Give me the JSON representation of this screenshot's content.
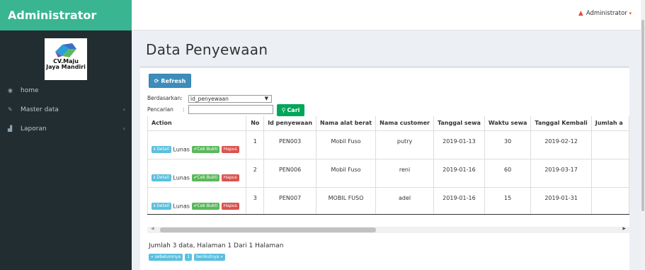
{
  "brand": "Administrator",
  "logo": {
    "line1": "CV.Maju",
    "line2": "Jaya Mandiri"
  },
  "sidebar": {
    "items": [
      {
        "label": "home",
        "icon": "dashboard-icon"
      },
      {
        "label": "Master data",
        "icon": "edit-icon",
        "has_chevron": true
      },
      {
        "label": "Laporan",
        "icon": "chart-icon",
        "has_chevron": true
      }
    ]
  },
  "topbar": {
    "user": "Administrator"
  },
  "page": {
    "title": "Data Penyewaan"
  },
  "toolbar": {
    "refresh_label": "Refresh",
    "filter_label": "Berdasarkan",
    "filter_value": "id_penyewaan",
    "search_label": "Pencarian",
    "search_value": "",
    "search_button": "Cari"
  },
  "table": {
    "headers": [
      "Action",
      "No",
      "Id penyewaan",
      "Nama alat berat",
      "Nama customer",
      "Tanggal sewa",
      "Waktu sewa",
      "Tanggal Kembali",
      "Jumlah a"
    ],
    "action_labels": {
      "detail": "Detail",
      "status": "Lunas",
      "cek": "Cek Bukti",
      "hapus": "Hapus"
    },
    "rows": [
      {
        "no": "1",
        "id": "PEN003",
        "alat": "Mobil Fuso",
        "customer": "putry",
        "tgl_sewa": "2019-01-13",
        "waktu": "30",
        "tgl_kembali": "2019-02-12"
      },
      {
        "no": "2",
        "id": "PEN006",
        "alat": "Mobil Fuso",
        "customer": "reni",
        "tgl_sewa": "2019-01-16",
        "waktu": "60",
        "tgl_kembali": "2019-03-17"
      },
      {
        "no": "3",
        "id": "PEN007",
        "alat": "MOBIL FUSO",
        "customer": "adel",
        "tgl_sewa": "2019-01-16",
        "waktu": "15",
        "tgl_kembali": "2019-01-31"
      }
    ]
  },
  "summary": "Jumlah 3 data, Halaman 1 Dari 1 Halaman",
  "pager": {
    "prev": "« sebelumnya",
    "page": "1",
    "next": "berikutnya »"
  },
  "colors": {
    "brand": "#39b591",
    "sidebar": "#222d32",
    "primary": "#3c8dbc",
    "success": "#00a65a",
    "info": "#5bc0de",
    "danger": "#d9534f"
  }
}
